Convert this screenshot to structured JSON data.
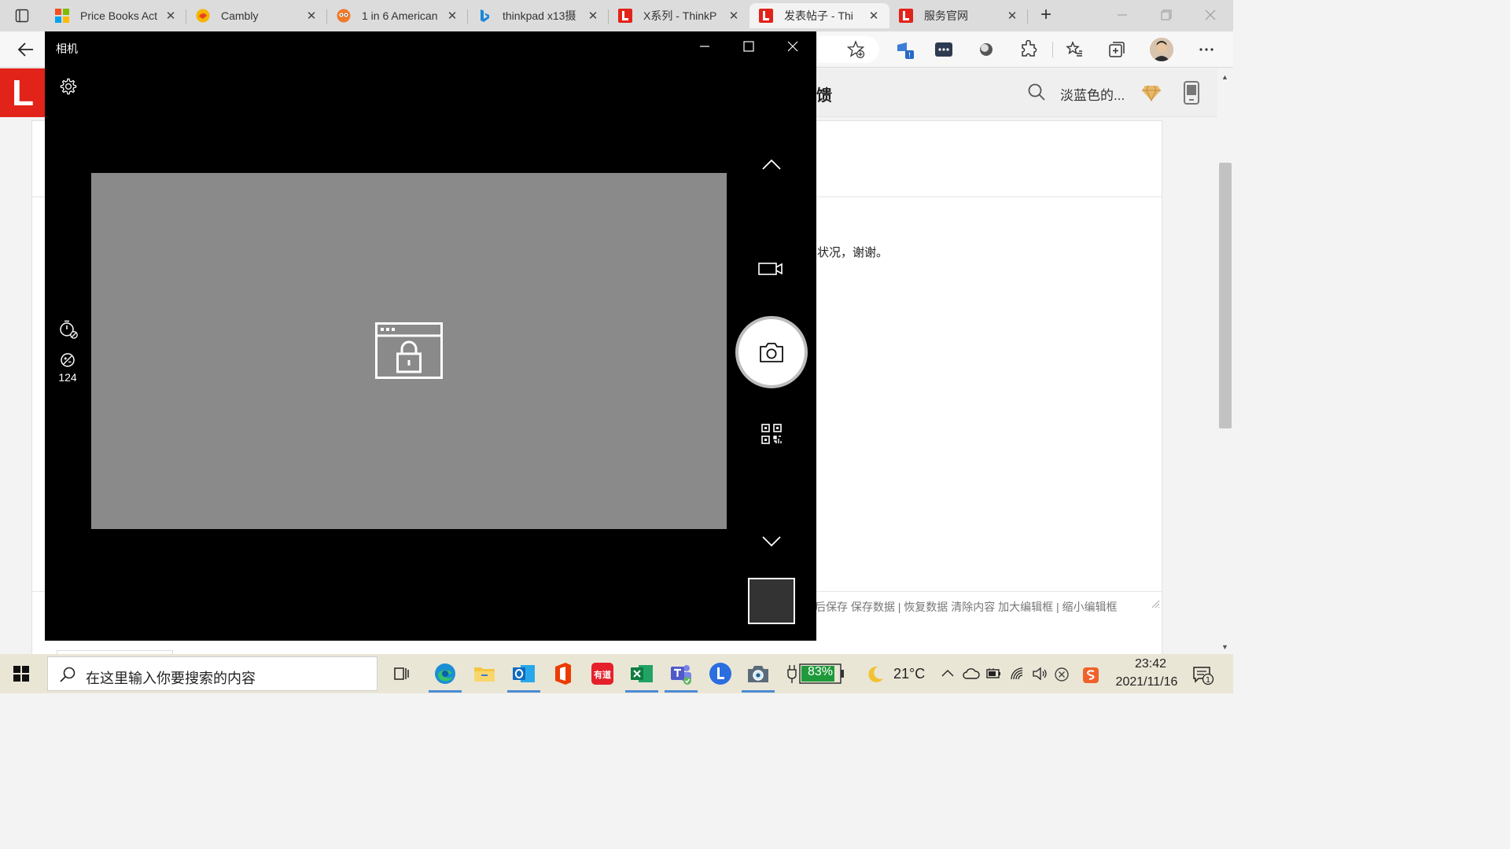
{
  "browser": {
    "tabs": [
      {
        "title": "Price Books Act",
        "favicon": "microsoft-logo-icon",
        "active": false
      },
      {
        "title": "Cambly",
        "favicon": "cambly-icon",
        "active": false
      },
      {
        "title": "1 in 6 American",
        "favicon": "owl-icon",
        "active": false
      },
      {
        "title": "thinkpad x13摄",
        "favicon": "bing-icon",
        "active": false
      },
      {
        "title": "X系列 - ThinkP",
        "favicon": "lenovo-l-icon",
        "active": false
      },
      {
        "title": "发表帖子 - Thi",
        "favicon": "lenovo-l-icon",
        "active": true
      },
      {
        "title": "服务官网",
        "favicon": "lenovo-l-icon",
        "active": false
      }
    ],
    "new_tab_label": "+",
    "close_label": "✕"
  },
  "website": {
    "logo_letter": "L",
    "header_feedback": "馈",
    "user_name": "淡蓝色的...",
    "post_text": "状况，谢谢。",
    "editor_links": "后保存 保存数据 | 恢复数据    清除内容    加大编辑框 | 缩小编辑框"
  },
  "camera": {
    "title": "相机",
    "exposure_value": "124"
  },
  "taskbar": {
    "search_placeholder": "在这里输入你要搜索的内容",
    "battery_percent": "83%",
    "temperature": "21°C",
    "time": "23:42",
    "date": "2021/11/16",
    "notification_count": "1",
    "youdao_label": "有道"
  },
  "colors": {
    "lenovo_red": "#e2231a",
    "camera_bg": "#000000",
    "viewfinder": "#8a8a8a",
    "taskbar": "#eae6d6",
    "battery_green": "#1f9a3a"
  }
}
